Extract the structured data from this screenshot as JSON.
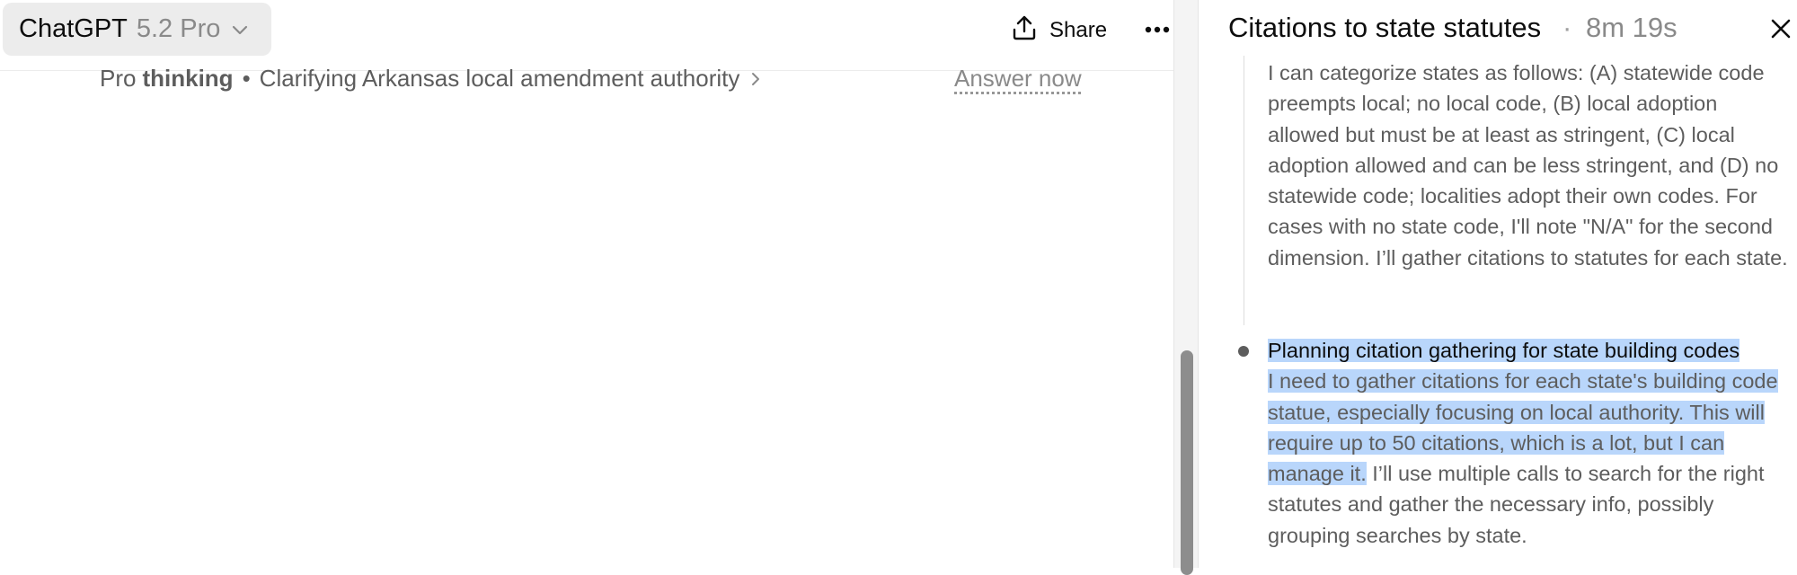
{
  "header": {
    "model_name": "ChatGPT",
    "model_version": "5.2 Pro",
    "share_label": "Share"
  },
  "status": {
    "pro": "Pro",
    "thinking": "thinking",
    "separator": "•",
    "text": "Clarifying Arkansas local amendment authority",
    "answer_now": "Answer now"
  },
  "panel": {
    "title": "Citations to state statutes",
    "separator": "·",
    "elapsed": "8m 19s",
    "step1_body": "I can categorize states as follows: (A) statewide code preempts local; no local code, (B) local adoption allowed but must be at least as stringent, (C) local adoption allowed and can be less stringent, and (D) no statewide code; localities adopt their own codes. For cases with no state code, I'll note \"N/A\" for the second dimension. I’ll gather citations to statutes for each state.",
    "step2_title": "Planning citation gathering for state building codes",
    "step2_body_selected": "I need to gather citations for each state's building code statue, especially focusing on local authority. This will require up to 50 citations, which is a lot, but I can manage it.",
    "step2_body_rest": " I’ll use multiple calls to search for the right statutes and gather the necessary info, possibly grouping searches by state."
  },
  "colors": {
    "selection": "#b9d6fb",
    "model_button_bg": "#ececec",
    "scroll_thumb": "#8d8d8d"
  },
  "icons": {
    "model_dropdown": "chevron-down-icon",
    "share": "share-upload-icon",
    "more": "more-horizontal-icon",
    "status_expand": "chevron-right-icon",
    "close": "close-icon"
  }
}
